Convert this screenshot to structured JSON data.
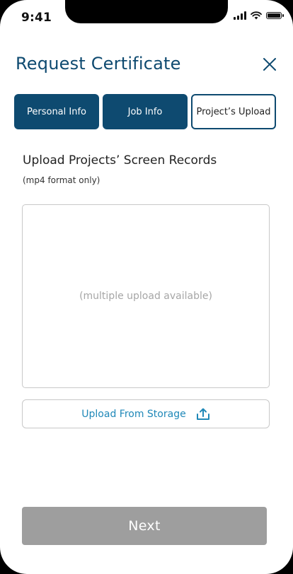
{
  "status_bar": {
    "time": "9:41"
  },
  "header": {
    "title": "Request Certificate",
    "close_icon": "close-icon"
  },
  "tabs": [
    {
      "label": "Personal Info",
      "state": "completed"
    },
    {
      "label": "Job Info",
      "state": "completed"
    },
    {
      "label": "Project’s Upload",
      "state": "active"
    }
  ],
  "upload_section": {
    "heading": "Upload Projects’ Screen Records",
    "format_note": "(mp4 format only)",
    "drop_hint": "(multiple upload available)",
    "upload_button_label": "Upload From Storage",
    "upload_icon": "upload-icon"
  },
  "footer": {
    "next_label": "Next"
  },
  "colors": {
    "primary": "#0e4a70",
    "link": "#1f88b8",
    "disabled": "#9e9e9e",
    "border": "#c8c8c8"
  }
}
